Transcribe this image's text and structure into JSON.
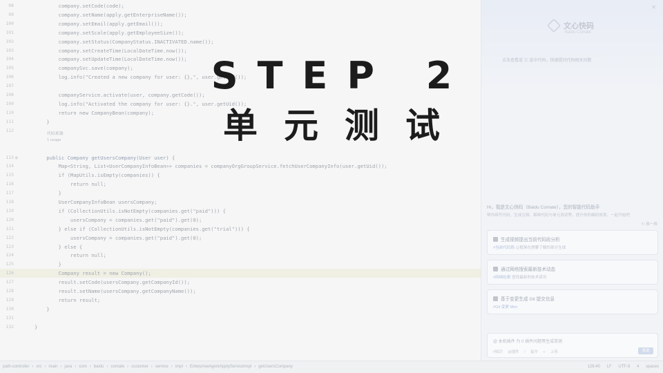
{
  "overlay": {
    "title": "STEP 2",
    "subtitle": "单元测试"
  },
  "editor": {
    "lines": [
      {
        "n": "98",
        "code": "        company.setCode(code);"
      },
      {
        "n": "99",
        "code": "        company.setName(apply.getEnterpriseName());"
      },
      {
        "n": "100",
        "code": "        company.setEmail(apply.getEmail());"
      },
      {
        "n": "101",
        "code": "        company.setScale(apply.getEmployeeSize());"
      },
      {
        "n": "102",
        "code": "        company.setStatus(CompanyStatus.INACTIVATED.name());"
      },
      {
        "n": "103",
        "code": "        company.setCreateTime(LocalDateTime.now());"
      },
      {
        "n": "104",
        "code": "        company.setUpdateTime(LocalDateTime.now());"
      },
      {
        "n": "105",
        "code": "        companySvc.save(company);"
      },
      {
        "n": "106",
        "code": "        log.info(\"Created a new company for user: {},\", user.getUid());"
      },
      {
        "n": "107",
        "code": ""
      },
      {
        "n": "108",
        "code": "        companyService.activate(user, company.getCode());"
      },
      {
        "n": "109",
        "code": "        log.info(\"Activated the company for user: {}.\", user.getUid());"
      },
      {
        "n": "110",
        "code": "        return new CompanyBean(company);"
      },
      {
        "n": "111",
        "code": "    }"
      },
      {
        "n": "112",
        "code": ""
      },
      {
        "n": "113",
        "code": "    public Company getUsersCompany(User user) {"
      },
      {
        "n": "114",
        "code": "        Map<String, List<UserCompanyInfoBean>> companies = companyOrgGroupService.fetchUserCompanyInfo(user.getUid());"
      },
      {
        "n": "115",
        "code": "        if (MapUtils.isEmpty(companies)) {"
      },
      {
        "n": "116",
        "code": "            return null;"
      },
      {
        "n": "117",
        "code": "        }"
      },
      {
        "n": "118",
        "code": "        UserCompanyInfoBean usersCompany;"
      },
      {
        "n": "119",
        "code": "        if (CollectionUtils.isNotEmpty(companies.get(\"paid\"))) {"
      },
      {
        "n": "120",
        "code": "            usersCompany = companies.get(\"paid\").get(0);"
      },
      {
        "n": "121",
        "code": "        } else if (CollectionUtils.isNotEmpty(companies.get(\"trial\"))) {"
      },
      {
        "n": "122",
        "code": "            usersCompany = companies.get(\"paid\").get(0);"
      },
      {
        "n": "123",
        "code": "        } else {"
      },
      {
        "n": "124",
        "code": "            return null;"
      },
      {
        "n": "125",
        "code": "        }"
      },
      {
        "n": "126",
        "code": "        Company result = new Company();"
      },
      {
        "n": "127",
        "code": "        result.setCode(usersCompany.getCompanyId());"
      },
      {
        "n": "128",
        "code": "        result.setName(usersCompany.getCompanyName());"
      },
      {
        "n": "129",
        "code": "        return result;"
      },
      {
        "n": "130",
        "code": "    }"
      },
      {
        "n": "131",
        "code": ""
      },
      {
        "n": "132",
        "code": "}"
      }
    ],
    "hint_usage": "1 usage",
    "hint_author": "代码来源:"
  },
  "panel": {
    "brand_name": "文心快码",
    "brand_sub": "Baidu Comate",
    "tip": "点击查看或 ⌘ 选中代码，快速提问代码相关问题",
    "greeting": "Hi，我是文心快码（Baidu Comate），您的智能代码助手",
    "greeting_sub": "帮你续写代码、生成注释、解释代码与单元测试等，提升你的编码效率，一起开始吧",
    "refresh": "↻ 换一换",
    "cards": [
      {
        "title": "生成视频提出当前代码段分析",
        "tag": "#当前代码段",
        "desc": "让框架在想要了解的部分生成"
      },
      {
        "title": "通过网络搜索最新技术动态",
        "tag": "#网络检索",
        "desc": "查找最新的技术资讯"
      },
      {
        "title": "基于变更生成 Git 提交信息",
        "tag": "#Git 变更 Mini",
        "desc": ""
      }
    ],
    "chat_hint": "@ 本机插件 为 0 插件问题等生成单测",
    "chat_tools": [
      "#知识",
      "@插件",
      "/ 指令",
      "+ 上传"
    ],
    "chat_send": "发送"
  },
  "statusbar": {
    "crumbs": [
      "path-controller",
      "src",
      "main",
      "java",
      "com",
      "baidu",
      "comate",
      "customer",
      "service",
      "impl",
      "EnterpriseAgentApplyServiceImpl",
      "getUsersCompany"
    ],
    "right": [
      "126:40",
      "LF",
      "UTF-8",
      "4 spaces"
    ]
  }
}
